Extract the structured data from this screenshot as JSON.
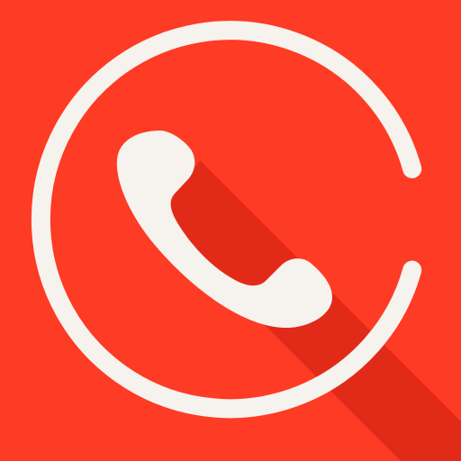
{
  "icon": {
    "name": "call-app-icon",
    "glyph": "phone-handset-icon",
    "ring": "progress-ring-icon",
    "colors": {
      "background": "#fe3b24",
      "long_shadow": "#e22a19",
      "foreground": "#f6f2ee"
    }
  }
}
